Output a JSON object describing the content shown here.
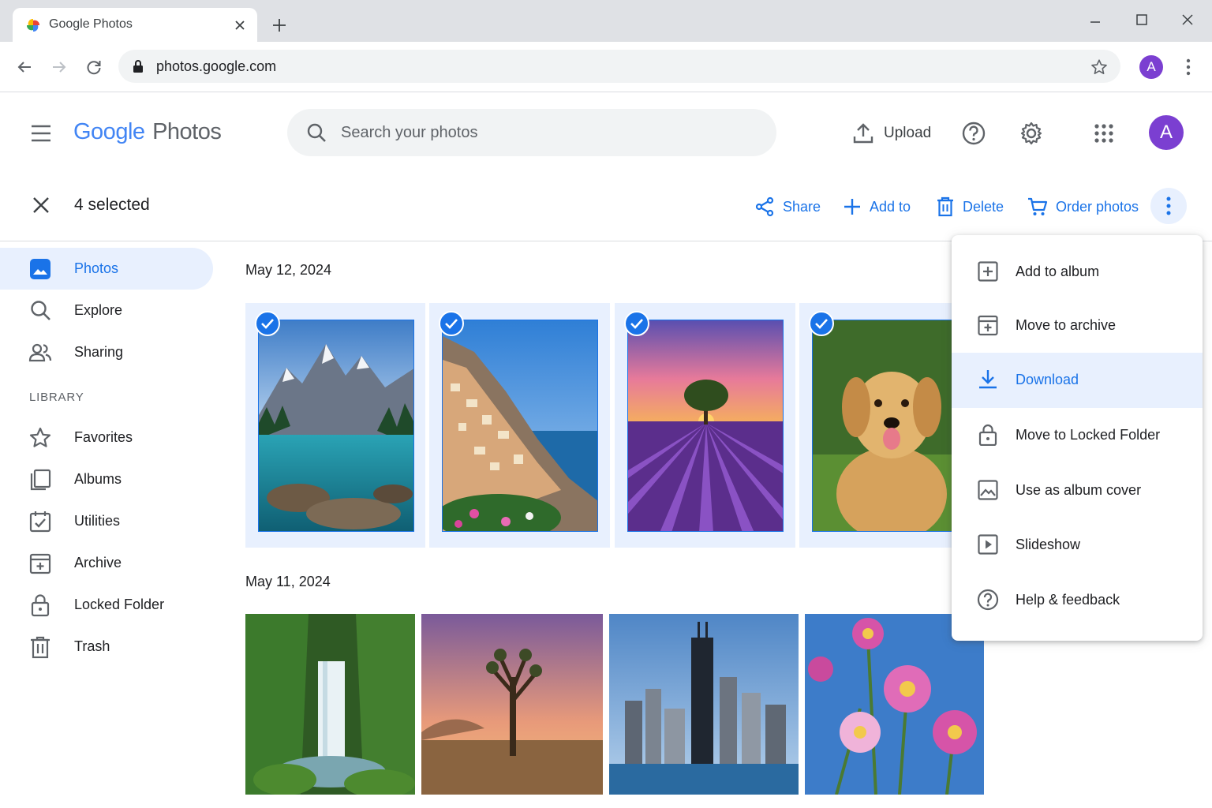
{
  "browser": {
    "tab_title": "Google Photos",
    "url": "photos.google.com",
    "profile_initial": "A"
  },
  "header": {
    "logo_google": "Google",
    "logo_photos": "Photos",
    "search_placeholder": "Search your photos",
    "upload_label": "Upload",
    "account_initial": "A"
  },
  "selection": {
    "count_label": "4 selected",
    "actions": {
      "share": "Share",
      "add_to": "Add to",
      "delete": "Delete",
      "order": "Order photos"
    }
  },
  "sidebar": {
    "items": [
      {
        "label": "Photos",
        "icon": "photos-icon"
      },
      {
        "label": "Explore",
        "icon": "search-icon"
      },
      {
        "label": "Sharing",
        "icon": "people-icon"
      }
    ],
    "library_heading": "LIBRARY",
    "library_items": [
      {
        "label": "Favorites",
        "icon": "star-icon"
      },
      {
        "label": "Albums",
        "icon": "albums-icon"
      },
      {
        "label": "Utilities",
        "icon": "utilities-icon"
      },
      {
        "label": "Archive",
        "icon": "archive-icon"
      },
      {
        "label": "Locked Folder",
        "icon": "lock-icon"
      },
      {
        "label": "Trash",
        "icon": "trash-icon"
      }
    ]
  },
  "groups": [
    {
      "date": "May 12, 2024",
      "photos": [
        "mountain-lake",
        "coastal-village",
        "lavander-field-tree",
        "golden-retriever"
      ]
    },
    {
      "date": "May 11, 2024",
      "photos": [
        "waterfall",
        "joshua-tree",
        "city-skyline",
        "pink-flowers"
      ]
    }
  ],
  "menu": {
    "items": [
      {
        "label": "Add to album",
        "icon": "add-box-icon"
      },
      {
        "label": "Move to archive",
        "icon": "archive-icon"
      },
      {
        "label": "Download",
        "icon": "download-icon"
      },
      {
        "label": "Move to Locked Folder",
        "icon": "lock-icon"
      },
      {
        "label": "Use as album cover",
        "icon": "image-icon"
      },
      {
        "label": "Slideshow",
        "icon": "slideshow-icon"
      },
      {
        "label": "Help & feedback",
        "icon": "help-icon"
      }
    ],
    "highlighted_item": "Download"
  },
  "colors": {
    "accent": "#1a73e8",
    "selection_bg": "#e8f0fe",
    "avatar": "#7b3fd1"
  }
}
